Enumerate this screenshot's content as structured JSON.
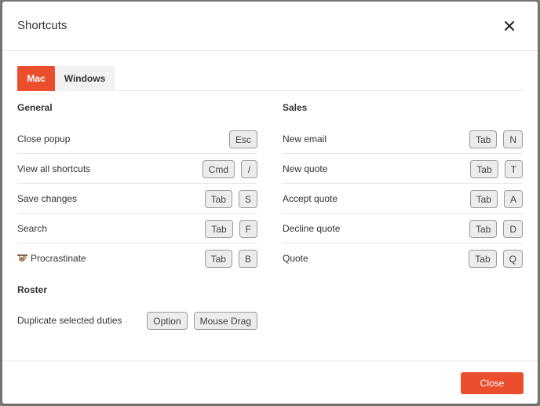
{
  "modal": {
    "title": "Shortcuts",
    "close_button_label": "Close"
  },
  "tabs": [
    {
      "label": "Mac",
      "active": true
    },
    {
      "label": "Windows",
      "active": false
    }
  ],
  "general": {
    "title": "General",
    "rows": [
      {
        "label": "Close popup",
        "keys": [
          "Esc"
        ]
      },
      {
        "label": "View all shortcuts",
        "keys": [
          "Cmd",
          "/"
        ]
      },
      {
        "label": "Save changes",
        "keys": [
          "Tab",
          "S"
        ]
      },
      {
        "label": "Search",
        "keys": [
          "Tab",
          "F"
        ]
      },
      {
        "label": "Procrastinate",
        "icon": "sloth-icon",
        "keys": [
          "Tab",
          "B"
        ]
      }
    ]
  },
  "roster": {
    "title": "Roster",
    "rows": [
      {
        "label": "Duplicate selected duties",
        "keys": [
          "Option",
          "Mouse Drag"
        ]
      }
    ]
  },
  "sales": {
    "title": "Sales",
    "rows": [
      {
        "label": "New email",
        "keys": [
          "Tab",
          "N"
        ]
      },
      {
        "label": "New quote",
        "keys": [
          "Tab",
          "T"
        ]
      },
      {
        "label": "Accept quote",
        "keys": [
          "Tab",
          "A"
        ]
      },
      {
        "label": "Decline quote",
        "keys": [
          "Tab",
          "D"
        ]
      },
      {
        "label": "Quote",
        "keys": [
          "Tab",
          "Q"
        ]
      }
    ]
  },
  "colors": {
    "accent": "#ea4e2c",
    "key_bg": "#ececec",
    "divider": "#e6e6e6"
  }
}
